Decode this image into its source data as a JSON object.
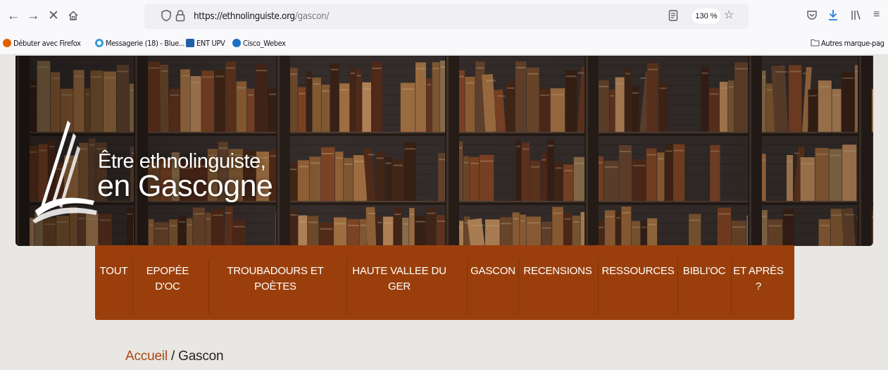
{
  "browser": {
    "back_icon": "arrow-left-icon",
    "forward_icon": "arrow-right-icon",
    "stop_icon": "close-icon",
    "home_icon": "home-icon",
    "url_host": "https://ethnolinguiste.org",
    "url_path": "/gascon/",
    "zoom": "130 %",
    "bookmarks": [
      {
        "label": "Débuter avec Firefox",
        "color": "#e66000"
      },
      {
        "label": "Messagerie (18) - Blue...",
        "color": "#3b9bd8"
      },
      {
        "label": "ENT UPV",
        "color": "#1f5fa8"
      },
      {
        "label": "Cisco_Webex",
        "color": "#1b6fc7"
      }
    ],
    "other_bookmarks": "Autres marque-pag"
  },
  "site": {
    "title_line1": "Être ethnolinguiste,",
    "title_line2": "en Gascogne",
    "accent_color": "#9a3f0c"
  },
  "menu": {
    "items": [
      {
        "label": "TOUT"
      },
      {
        "label": "EPOPÉE D'OC"
      },
      {
        "label": "TROUBADOURS ET POÈTES"
      },
      {
        "label": "HAUTE VALLEE DU GER"
      },
      {
        "label": "GASCON"
      },
      {
        "label": "RECENSIONS"
      },
      {
        "label": "RESSOURCES"
      },
      {
        "label": "BIBLI'OC"
      },
      {
        "label": "ET APRÈS ?"
      }
    ]
  },
  "breadcrumb": {
    "home": "Accueil",
    "separator": " / ",
    "current": "Gascon"
  }
}
